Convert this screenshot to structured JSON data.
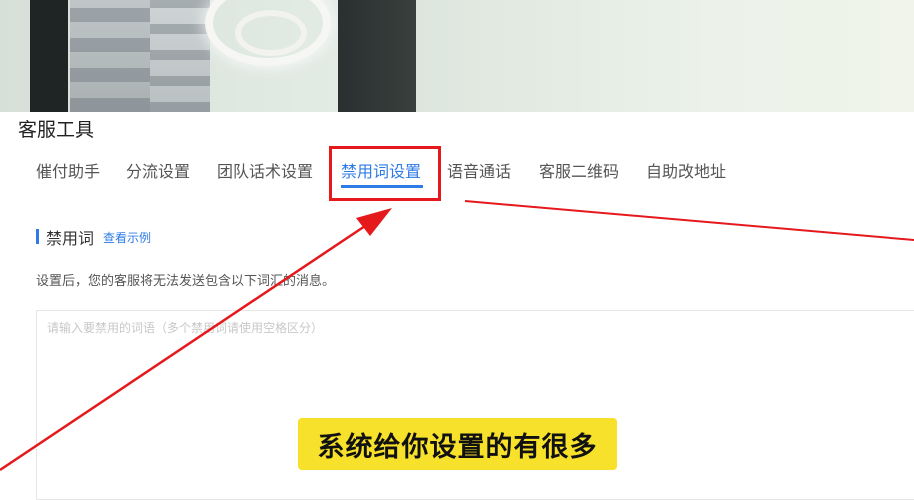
{
  "page": {
    "title": "客服工具"
  },
  "tabs": [
    {
      "label": "催付助手"
    },
    {
      "label": "分流设置"
    },
    {
      "label": "团队话术设置"
    },
    {
      "label": "禁用词设置",
      "active": true
    },
    {
      "label": "语音通话"
    },
    {
      "label": "客服二维码"
    },
    {
      "label": "自助改地址"
    }
  ],
  "section": {
    "title": "禁用词",
    "link": "查看示例",
    "description": "设置后，您的客服将无法发送包含以下词汇的消息。"
  },
  "input": {
    "placeholder": "请输入要禁用的词语（多个禁用词请使用空格区分）",
    "value": ""
  },
  "caption": {
    "text": "系统给你设置的有很多"
  },
  "colors": {
    "accent": "#2f7be5",
    "annotation": "#e5191c",
    "caption_bg": "#f7e12a"
  }
}
